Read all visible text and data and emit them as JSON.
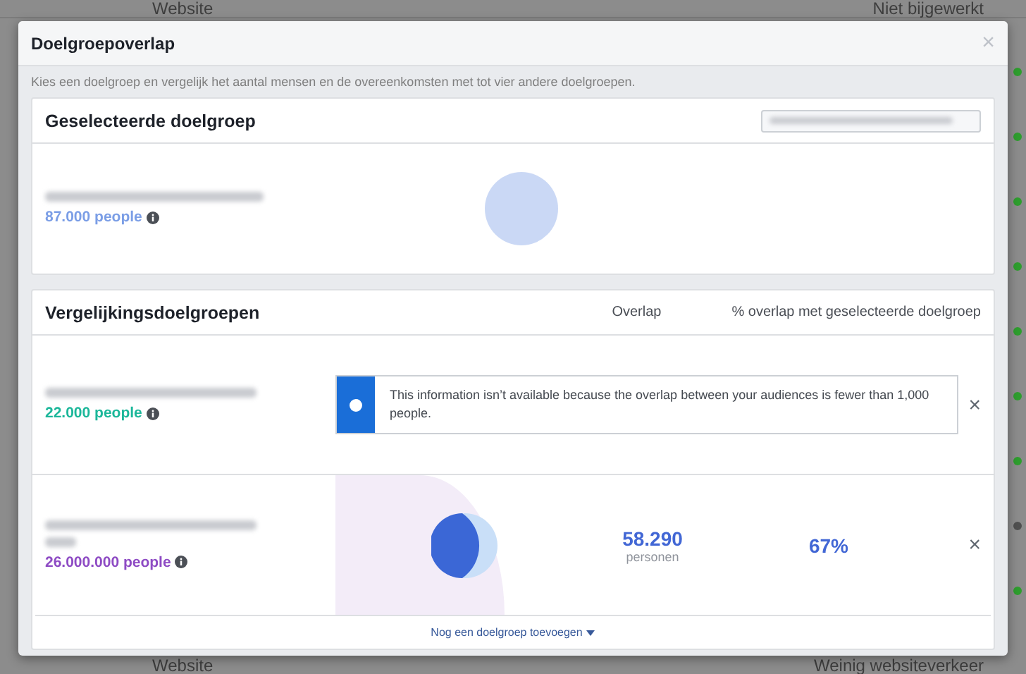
{
  "background": {
    "top_row": {
      "column_1": "Website",
      "column_2": "Niet bijgewerkt"
    },
    "bottom_row": {
      "column_1": "Website",
      "column_2": "Weinig websiteverkeer"
    },
    "status_dots": [
      {
        "color": "#2e9e2e"
      },
      {
        "color": "#2e9e2e"
      },
      {
        "color": "#2e9e2e"
      },
      {
        "color": "#2e9e2e"
      },
      {
        "color": "#2e9e2e"
      },
      {
        "color": "#2e9e2e"
      },
      {
        "color": "#2e9e2e"
      },
      {
        "color": "#505050"
      },
      {
        "color": "#2e9e2e"
      }
    ]
  },
  "dialog": {
    "title": "Doelgroepoverlap",
    "close": "×",
    "intro": "Kies een doelgroep en vergelijk het aantal mensen en de overeenkomsten met tot vier andere doelgroepen.",
    "selected": {
      "heading": "Geselecteerde doelgroep",
      "audience": {
        "size": "87.000 people",
        "color": "#7b9ee6"
      }
    },
    "comparison": {
      "heading": "Vergelijkingsdoelgroepen",
      "column_overlap": "Overlap",
      "column_percent": "% overlap met geselecteerde doelgroep",
      "rows": [
        {
          "kind": "notice",
          "size": "22.000 people",
          "color": "#1cb79a",
          "notice": "This information isn’t available because the overlap between your audiences is fewer than 1,000 people.",
          "remove": "×"
        },
        {
          "kind": "overlap",
          "size": "26.000.000 people",
          "color": "#8e4bc4",
          "overlap": "58.290",
          "overlap_unit": "personen",
          "percent": "67%",
          "remove": "×"
        }
      ],
      "add_link": "Nog een doelgroep toevoegen"
    }
  }
}
